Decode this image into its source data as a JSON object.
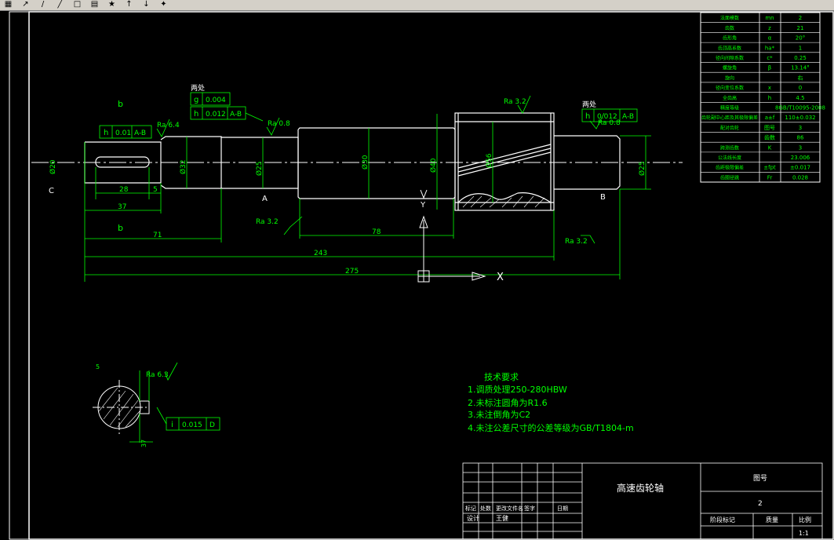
{
  "toolbar": {
    "icons": [
      "new-icon",
      "edit-icon",
      "draw-icon",
      "line-icon",
      "rectangle-icon",
      "table-icon",
      "star-icon",
      "pin-icon",
      "pin-icon",
      "magic-icon"
    ],
    "glyphs": [
      "▦",
      "↗",
      "/",
      "╱",
      "□",
      "▤",
      "★",
      "↑",
      "↓",
      "✦"
    ]
  },
  "drawing": {
    "colors": {
      "background": "#000000",
      "line": "#ffffff",
      "dimension": "#00ff00",
      "center": "#ffffff",
      "axis": "#ffffff"
    },
    "shaft_diameters": {
      "d1": "Ø20",
      "d2": "Ø32",
      "d3": "Ø25",
      "d4": "Ø30",
      "d5": "Ø40",
      "d6": "Ø56",
      "d7": "Ø25"
    },
    "lengths": {
      "keyway": "28",
      "small": "5",
      "seg37": "37",
      "seg71": "71",
      "seg78": "78",
      "seg243": "243",
      "seg275": "275"
    },
    "roughness": {
      "r1": "Ra 6.4",
      "r2": "Ra 0.8",
      "r3": "Ra 3.2",
      "r4": "Ra 0.8",
      "r5": "Ra 3.2",
      "r6": "Ra 3.2",
      "r7": "Ra 6.3"
    },
    "tolerance_frames": {
      "f1_sym": "h",
      "f1_val": "0.01",
      "f1_ref": "A-B",
      "f2_sym": "g",
      "f2_val": "0.004",
      "f3_sym": "h",
      "f3_val": "0.012",
      "f3_ref": "A-B",
      "f4_sym": "h",
      "f4_val": "0.012",
      "f4_ref": "A-B",
      "f5_sym": "i",
      "f5_val": "0.015",
      "f5_ref": "D"
    },
    "labels": {
      "two_places_1": "两处",
      "two_places_2": "两处",
      "datum_a": "A",
      "datum_b": "B",
      "datum_c": "C",
      "axis_x": "X",
      "axis_y": "Y",
      "flag1": "b",
      "flag2": "b"
    }
  },
  "params_table": {
    "rows": [
      {
        "name": "法面模数",
        "sym": "mn",
        "val": "2"
      },
      {
        "name": "齿数",
        "sym": "z",
        "val": "21"
      },
      {
        "name": "齿形角",
        "sym": "α",
        "val": "20°"
      },
      {
        "name": "齿顶高系数",
        "sym": "ha*",
        "val": "1"
      },
      {
        "name": "径向间隙系数",
        "sym": "c*",
        "val": "0.25"
      },
      {
        "name": "螺旋角",
        "sym": "β",
        "val": "13.14°"
      },
      {
        "name": "旋向",
        "sym": "",
        "val": "右"
      },
      {
        "name": "径向变位系数",
        "sym": "x",
        "val": "0"
      },
      {
        "name": "全齿高",
        "sym": "h",
        "val": "4.5"
      },
      {
        "name": "精度等级",
        "sym": "",
        "val": "8GB/T10095-2008"
      },
      {
        "name": "齿轮副中心距及其极限偏差",
        "sym": "a±f",
        "val": "110±0.032"
      },
      {
        "name": "配对齿轮",
        "sym": "图号",
        "val": "3"
      },
      {
        "name": "",
        "sym": "齿数",
        "val": "86"
      },
      {
        "name": "跨测齿数",
        "sym": "K",
        "val": "3"
      },
      {
        "name": "公法线长度",
        "sym": "",
        "val": "23.006"
      },
      {
        "name": "齿距极限偏差",
        "sym": "±fpt",
        "val": "±0.017"
      },
      {
        "name": "齿圈径跳",
        "sym": "Fr",
        "val": "0.028"
      }
    ]
  },
  "tech_requirements": {
    "title": "技术要求",
    "items": [
      "1.调质处理250-280HBW",
      "2.未标注圆角为R1.6",
      "3.未注倒角为C2",
      "4.未注公差尺寸的公差等级为GB/T1804-m"
    ]
  },
  "title_block": {
    "part_name": "高速齿轮轴",
    "drawing_no_label": "图号",
    "drawing_no": "2",
    "header_cells": [
      "标记",
      "处数",
      "更改文件名",
      "签字",
      "日期"
    ],
    "design_label": "设计",
    "designer": "王健",
    "bottom_labels": [
      "阶段标记",
      "质量",
      "比例"
    ],
    "scale": "1:1"
  }
}
